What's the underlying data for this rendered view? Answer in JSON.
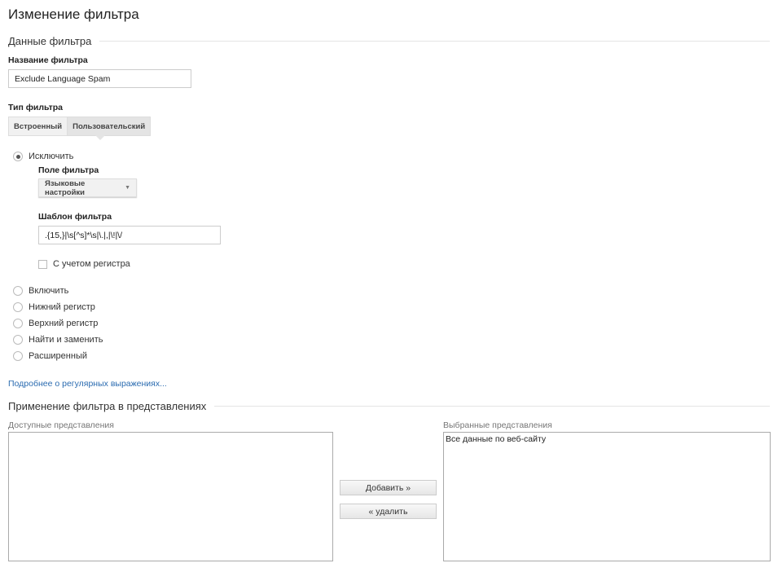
{
  "title": "Изменение фильтра",
  "section1": "Данные фильтра",
  "name_label": "Название фильтра",
  "name_value": "Exclude Language Spam",
  "type_label": "Тип фильтра",
  "type_tabs": [
    "Встроенный",
    "Пользовательский"
  ],
  "exclude_label": "Исключить",
  "field_label": "Поле фильтра",
  "field_value": "Языковые настройки",
  "pattern_label": "Шаблон фильтра",
  "pattern_value": ".{15,}|\\s[^s]*\\s|\\.|,|\\!|\\/",
  "case_label": "С учетом регистра",
  "radios": [
    "Включить",
    "Нижний регистр",
    "Верхний регистр",
    "Найти и заменить",
    "Расширенный"
  ],
  "regex_link": "Подробнее о регулярных выражениях...",
  "section2": "Применение фильтра в представлениях",
  "available_label": "Доступные представления",
  "selected_label": "Выбранные представления",
  "selected_items": [
    "Все данные по веб-сайту"
  ],
  "add_button": "Добавить »",
  "remove_button": "« удалить"
}
